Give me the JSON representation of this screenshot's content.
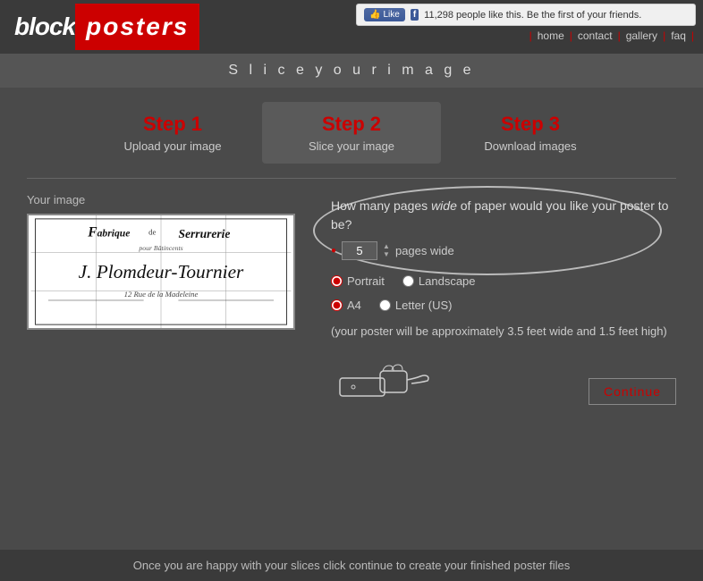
{
  "logo": {
    "block": "block",
    "posters": "posters"
  },
  "facebook": {
    "like_text": "Like",
    "count_text": "11,298 people like this. Be the first of your friends."
  },
  "nav": {
    "home": "home",
    "contact": "contact",
    "gallery": "gallery",
    "faq": "faq"
  },
  "page_title": "S l i c e   y o u r   i m a g e",
  "steps": [
    {
      "number": "Step 1",
      "label": "Upload your image",
      "active": false
    },
    {
      "number": "Step 2",
      "label": "Slice your image",
      "active": true
    },
    {
      "number": "Step 3",
      "label": "Download images",
      "active": false
    }
  ],
  "image_panel": {
    "label": "Your image"
  },
  "options": {
    "question_text": "How many pages ",
    "question_wide": "wide",
    "question_rest": " of paper would you like your poster to be?",
    "pages_value": "5",
    "pages_wide_label": "pages wide",
    "orientation_portrait": "Portrait",
    "orientation_landscape": "Landscape",
    "paper_a4": "A4",
    "paper_letter": "Letter (US)",
    "size_info": "(your poster will be approximately 3.5 feet wide and 1.5 feet high)",
    "continue_label": "Continue"
  },
  "footer": {
    "text": "Once you are happy with your slices click continue to create your finished poster files"
  }
}
